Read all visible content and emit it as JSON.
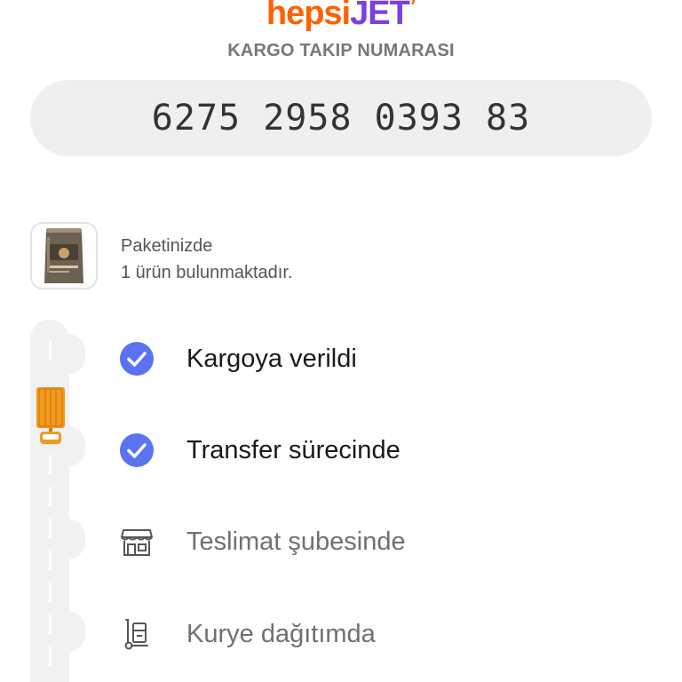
{
  "logo": {
    "part1": "hepsi",
    "part2": "JET",
    "mark": "’"
  },
  "tracking": {
    "label": "KARGO TAKIP NUMARASI",
    "number": "6275 2958 0393 83"
  },
  "package": {
    "line1": "Paketinizde",
    "line2": "1 ürün bulunmaktadır.",
    "thumbnail_icon": "coffee-bag-product-image"
  },
  "steps": [
    {
      "label": "Kargoya verildi",
      "status": "done",
      "icon": "check-circle-icon"
    },
    {
      "label": "Transfer sürecinde",
      "status": "done",
      "icon": "check-circle-icon"
    },
    {
      "label": "Teslimat şubesinde",
      "status": "pending",
      "icon": "store-icon"
    },
    {
      "label": "Kurye dağıtımda",
      "status": "pending",
      "icon": "hand-truck-icon"
    }
  ],
  "colors": {
    "brand_orange": "#ff6000",
    "brand_purple": "#7b3fe4",
    "check_blue": "#5b73f0",
    "truck_orange": "#f29a1f",
    "road_gray": "#f1f1f1"
  }
}
